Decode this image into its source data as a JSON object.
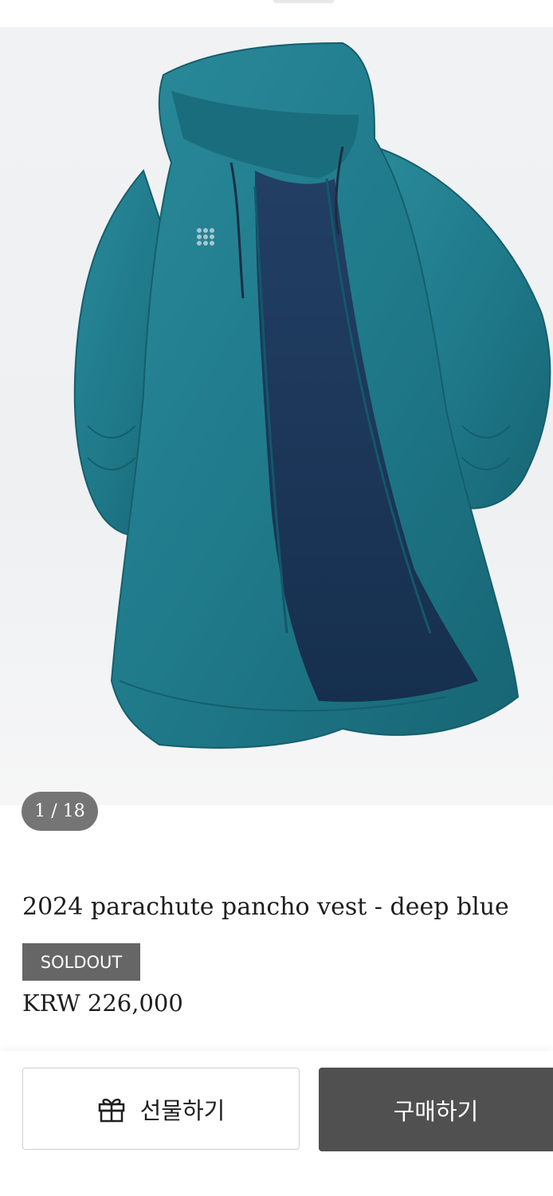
{
  "gallery": {
    "counter": "1 / 18",
    "image_alt_icon": "product-photo-jacket"
  },
  "product": {
    "title": "2024 parachute pancho vest - deep blue",
    "status_badge": "SOLDOUT",
    "price": "KRW 226,000"
  },
  "actions": {
    "gift_label": "선물하기",
    "gift_icon": "gift-icon",
    "buy_label": "구매하기"
  },
  "colors": {
    "jacket_teal": "#1f7b8c",
    "lining_navy": "#1c3a5e",
    "badge_gray": "#666666",
    "buy_button": "#505050"
  }
}
